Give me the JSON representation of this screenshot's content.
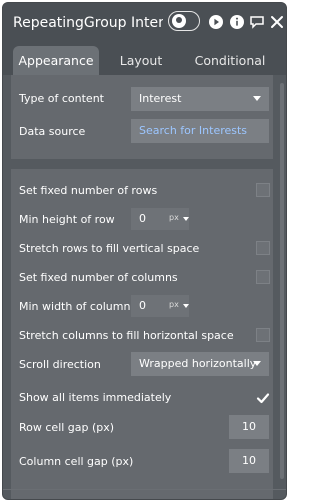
{
  "header": {
    "title": "RepeatingGroup Interest",
    "icons": [
      "toggle-switch",
      "play-icon",
      "info-icon",
      "comment-icon",
      "close-icon"
    ]
  },
  "tabs": [
    {
      "label": "Appearance",
      "active": true
    },
    {
      "label": "Layout",
      "active": false
    },
    {
      "label": "Conditional",
      "active": false
    }
  ],
  "content": {
    "type_of_content": {
      "label": "Type of content",
      "value": "Interest"
    },
    "data_source": {
      "label": "Data source",
      "placeholder": "Search for Interests"
    },
    "set_fixed_rows": {
      "label": "Set fixed number of rows",
      "checked": false
    },
    "min_height_row": {
      "label": "Min height of row",
      "value": "0",
      "unit": "px"
    },
    "stretch_rows": {
      "label": "Stretch rows to fill vertical space",
      "checked": false
    },
    "set_fixed_columns": {
      "label": "Set fixed number of columns",
      "checked": false
    },
    "min_width_column": {
      "label": "Min width of column",
      "value": "0",
      "unit": "px"
    },
    "stretch_columns": {
      "label": "Stretch columns to fill horizontal space",
      "checked": false
    },
    "scroll_direction": {
      "label": "Scroll direction",
      "value": "Wrapped horizontally"
    },
    "show_all_items": {
      "label": "Show all items immediately",
      "checked": true
    },
    "row_cell_gap": {
      "label": "Row cell gap (px)",
      "value": "10"
    },
    "column_cell_gap": {
      "label": "Column cell gap (px)",
      "value": "10"
    }
  },
  "colors": {
    "panel_bg": "#555a5f",
    "section_bg": "#65696e",
    "input_bg": "#7b7f84",
    "link_text": "#9cc6ff"
  }
}
